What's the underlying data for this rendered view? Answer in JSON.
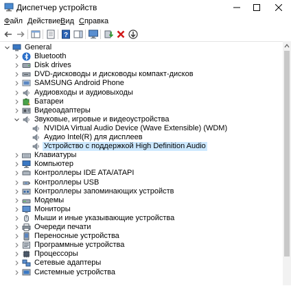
{
  "window": {
    "title": "Диспетчер устройств"
  },
  "menu": [
    "Файл",
    "Действие",
    "Вид",
    "Справка"
  ],
  "toolbar": [
    "back-arrow-icon",
    "forward-arrow-icon",
    "console-tree-icon",
    "properties-icon",
    "help-icon",
    "action-pane-icon",
    "monitor-icon",
    "update-driver-icon",
    "uninstall-icon",
    "scan-hardware-icon"
  ],
  "tree": {
    "root": "General",
    "categories": [
      {
        "label": "Bluetooth",
        "icon": "bluetooth-icon"
      },
      {
        "label": "Disk drives",
        "icon": "disk-drive-icon"
      },
      {
        "label": "DVD-дисководы и дисководы компакт-дисков",
        "icon": "dvd-drive-icon"
      },
      {
        "label": "SAMSUNG Android Phone",
        "icon": "phone-icon"
      },
      {
        "label": "Аудиовходы и аудиовыходы",
        "icon": "speaker-icon"
      },
      {
        "label": "Батареи",
        "icon": "battery-icon"
      },
      {
        "label": "Видеоадаптеры",
        "icon": "display-adapter-icon"
      },
      {
        "label": "Звуковые, игровые и видеоустройства",
        "icon": "speaker-icon",
        "expanded": true,
        "children": [
          {
            "label": "NVIDIA Virtual Audio Device (Wave Extensible) (WDM)",
            "icon": "speaker-icon"
          },
          {
            "label": "Аудио Intel(R) для дисплеев",
            "icon": "speaker-icon"
          },
          {
            "label": "Устройство с поддержкой High Definition Audio",
            "icon": "speaker-icon",
            "selected": true
          }
        ]
      },
      {
        "label": "Клавиатуры",
        "icon": "keyboard-icon"
      },
      {
        "label": "Компьютер",
        "icon": "computer-icon"
      },
      {
        "label": "Контроллеры IDE ATA/ATAPI",
        "icon": "ide-controller-icon"
      },
      {
        "label": "Контроллеры USB",
        "icon": "usb-icon"
      },
      {
        "label": "Контроллеры запоминающих устройств",
        "icon": "storage-controller-icon"
      },
      {
        "label": "Модемы",
        "icon": "modem-icon"
      },
      {
        "label": "Мониторы",
        "icon": "monitor-icon"
      },
      {
        "label": "Мыши и иные указывающие устройства",
        "icon": "mouse-icon"
      },
      {
        "label": "Очереди печати",
        "icon": "printer-icon"
      },
      {
        "label": "Переносные устройства",
        "icon": "portable-device-icon"
      },
      {
        "label": "Программные устройства",
        "icon": "software-device-icon"
      },
      {
        "label": "Процессоры",
        "icon": "processor-icon"
      },
      {
        "label": "Сетевые адаптеры",
        "icon": "network-adapter-icon"
      },
      {
        "label": "Системные устройства",
        "icon": "system-device-icon"
      }
    ]
  },
  "colors": {
    "selection": "#cce8ff",
    "accent": "#1e70c8"
  }
}
